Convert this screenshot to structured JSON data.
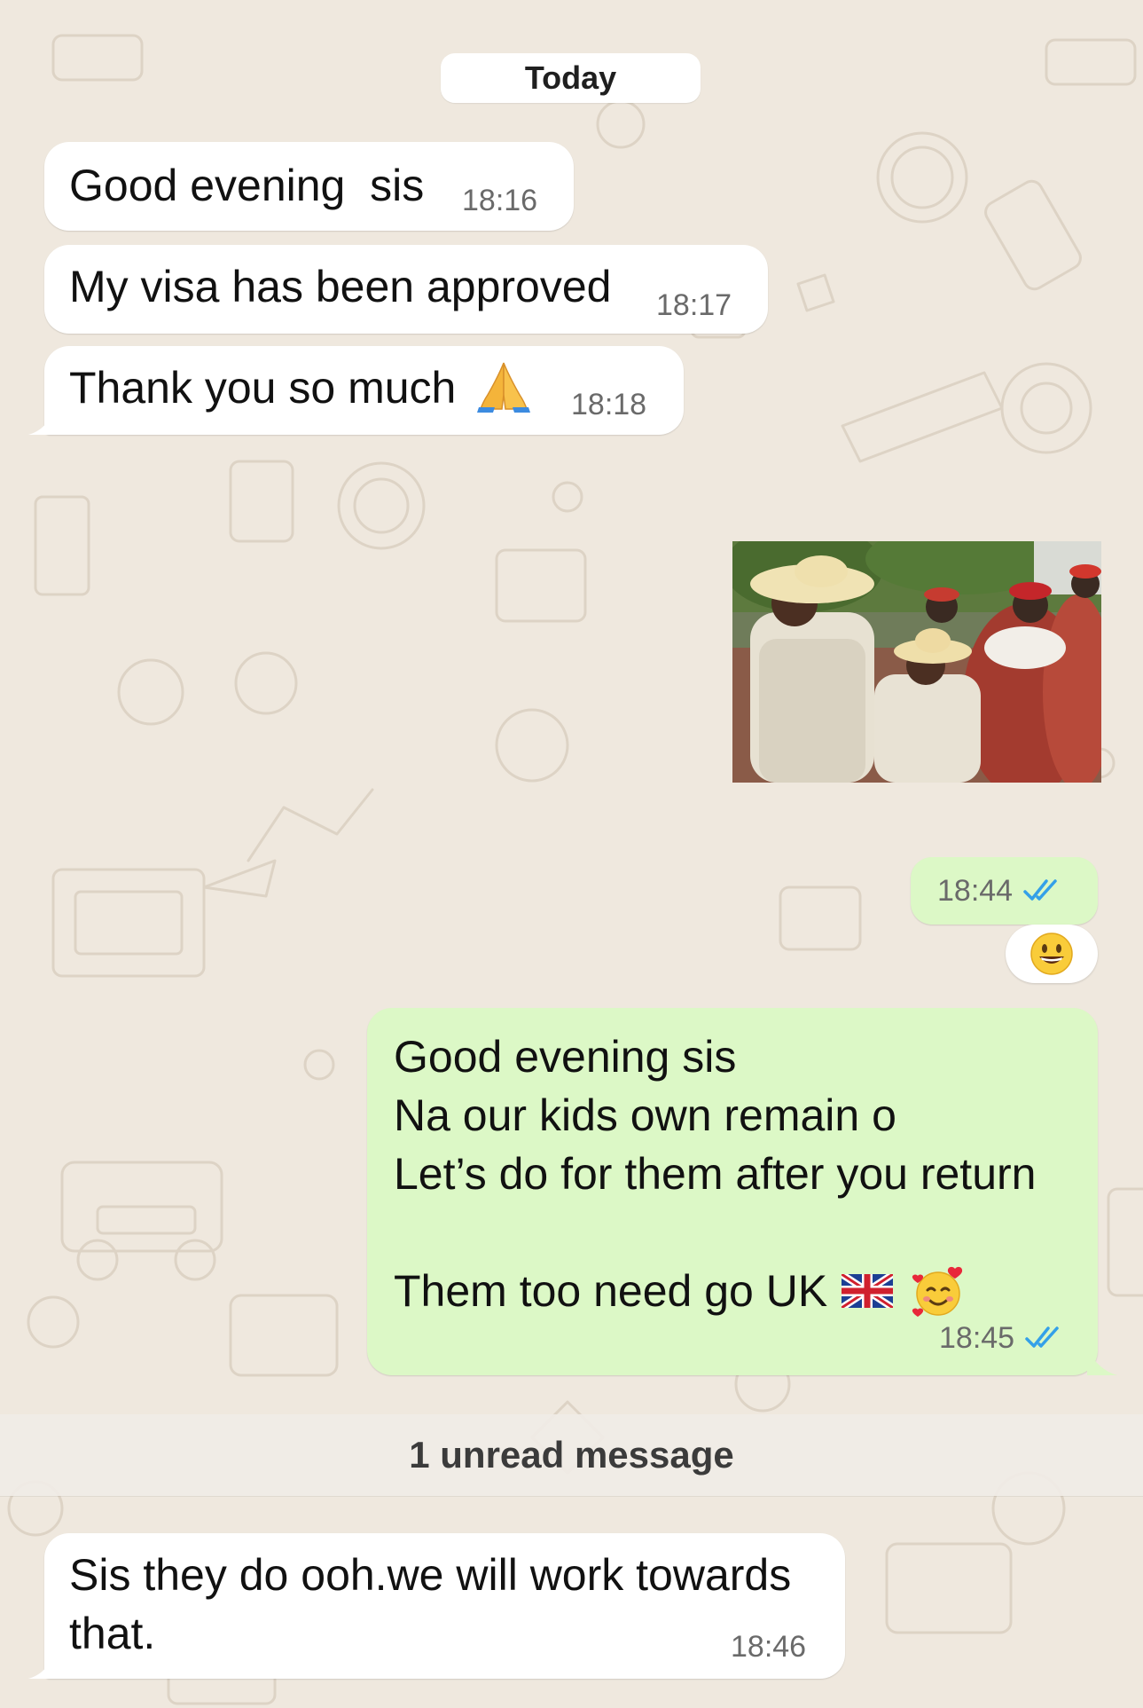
{
  "chat": {
    "date_label": "Today",
    "messages": [
      {
        "direction": "incoming",
        "text": "Good evening  sis",
        "time": "18:16"
      },
      {
        "direction": "incoming",
        "text": "My visa has been approved",
        "time": "18:17"
      },
      {
        "direction": "incoming",
        "text": "Thank you so much",
        "emoji": "folded-hands",
        "time": "18:18"
      },
      {
        "direction": "outgoing",
        "media": "video-thumbnail",
        "time": "18:44",
        "status": "read",
        "reaction": "grinning-face"
      },
      {
        "direction": "outgoing",
        "lines": [
          "Good evening sis",
          "Na our kids own remain o",
          "Let’s do for them after you return",
          "",
          "Them too need go UK"
        ],
        "emojis": [
          "flag-uk",
          "smiling-face-with-hearts"
        ],
        "time": "18:45",
        "status": "read"
      },
      {
        "direction": "incoming",
        "lines": [
          "Sis they do ooh.we will work towards",
          "that."
        ],
        "time": "18:46"
      }
    ],
    "unread_label": "1 unread message"
  },
  "colors": {
    "incoming_bubble": "#ffffff",
    "outgoing_bubble": "#dcf8c6",
    "read_ticks": "#34a0e8",
    "wallpaper": "#efe8de"
  }
}
